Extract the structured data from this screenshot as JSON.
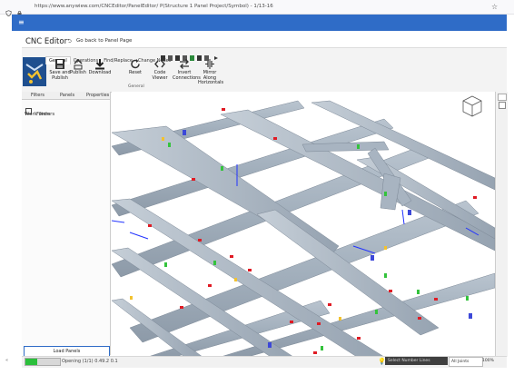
{
  "browser": {
    "url": "https://www.anywiew.com/CNCEditor/PanelEditor/  P(Structure 1  Panel Project/Symbol) - 1/13-16",
    "star_icon": "star-icon"
  },
  "app": {
    "title": "CNC Editor",
    "back_link": "Go back to Panel Page",
    "menu_icon": "hamburger-icon",
    "brand_color": "#2f6cc7"
  },
  "ribbon": {
    "tabs": [
      "General",
      "Operations",
      "Find/Replace",
      "Change Nodes"
    ],
    "active_tab": "General",
    "buttons": [
      {
        "label": "Save and Publish",
        "icon": "save-icon"
      },
      {
        "label": "Publish",
        "icon": "publish-icon"
      },
      {
        "label": "Download",
        "icon": "download-icon"
      },
      {
        "label": "Reset",
        "icon": "reset-icon"
      },
      {
        "label": "Code Viewer",
        "icon": "code-icon"
      },
      {
        "label": "Invert Connections",
        "icon": "invert-icon"
      },
      {
        "label": "Mirror Along Horizontals",
        "icon": "mirror-icon"
      }
    ],
    "group_label": "General"
  },
  "left_panel": {
    "tabs": [
      "Filters",
      "Panels",
      "Properties"
    ],
    "filter_label": "Filters",
    "section": "Work orders",
    "load_button": "Load Panels"
  },
  "status": {
    "progress": 0.35,
    "text": "Opening (1/1) 0.49.2 0.1",
    "selection": "Select Number Lines",
    "zoom": "All Joints",
    "last": "100%"
  }
}
